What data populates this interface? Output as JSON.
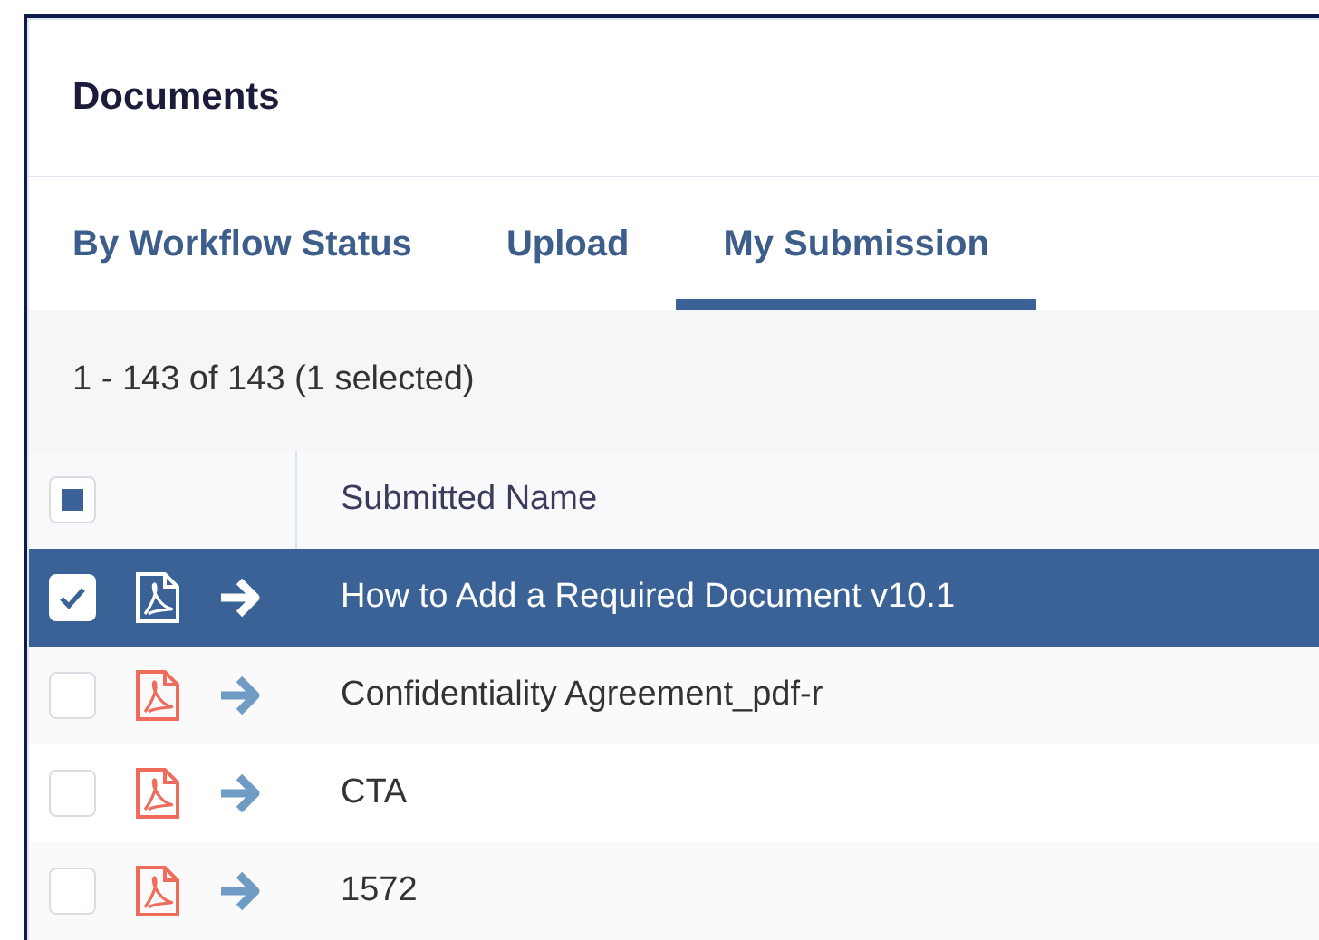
{
  "panel": {
    "title": "Documents"
  },
  "tabs": [
    {
      "label": "By Workflow Status",
      "selected": false
    },
    {
      "label": "Upload",
      "selected": false
    },
    {
      "label": "My Submission",
      "selected": true
    }
  ],
  "summary": "1 - 143 of 143 (1 selected)",
  "table": {
    "select_all": {
      "indeterminate": true
    },
    "columns": [
      "Submitted Name"
    ],
    "rows": [
      {
        "name": "How to Add a Required Document v10.1",
        "checked": true,
        "selected": true
      },
      {
        "name": "Confidentiality Agreement_pdf-r",
        "checked": false,
        "selected": false
      },
      {
        "name": "CTA",
        "checked": false,
        "selected": false
      },
      {
        "name": "1572",
        "checked": false,
        "selected": false
      }
    ]
  }
}
